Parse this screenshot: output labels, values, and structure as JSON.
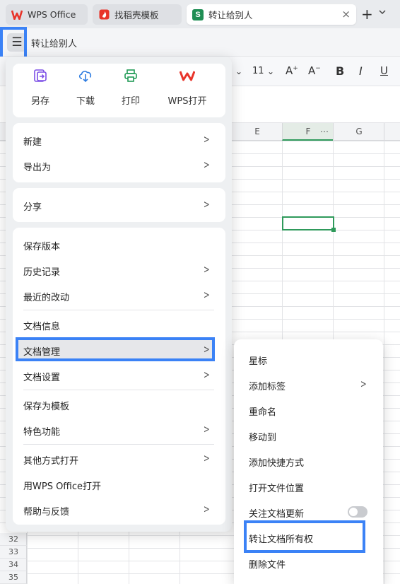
{
  "tabs": [
    {
      "label": "WPS Office",
      "icon": "wps-logo-icon",
      "active": false
    },
    {
      "label": "找稻壳模板",
      "icon": "docer-icon",
      "active": false
    },
    {
      "label": "转让给别人",
      "icon": "sheet-icon",
      "badge": "S",
      "active": true,
      "close": "×"
    }
  ],
  "tabbar": {
    "new_tab": "+",
    "more": "⌄"
  },
  "header": {
    "menu_icon": "☰",
    "doc_title": "转让给别人"
  },
  "toolbar": {
    "font_size": "11",
    "font_size_arrow": "⌄",
    "font_dropdown_arrow": "⌄",
    "grow": "A",
    "shrink": "A",
    "bold": "B",
    "italic": "I",
    "underline": "U"
  },
  "grid": {
    "columns": [
      {
        "label": "E"
      },
      {
        "label": "F",
        "extra": "⋯"
      },
      {
        "label": "G"
      }
    ],
    "rows": [
      "32",
      "33",
      "34",
      "35"
    ]
  },
  "menu": {
    "quick_actions": [
      {
        "label": "另存",
        "icon": "save-as-icon"
      },
      {
        "label": "下载",
        "icon": "download-icon"
      },
      {
        "label": "打印",
        "icon": "print-icon"
      },
      {
        "label": "WPS打开",
        "icon": "wps-open-icon"
      }
    ],
    "group1": [
      "新建",
      "导出为"
    ],
    "group2": [
      "分享"
    ],
    "group3": [
      "保存版本",
      "历史记录",
      "最近的改动",
      "文档信息",
      "文档管理",
      "文档设置",
      "保存为模板",
      "特色功能",
      "其他方式打开",
      "用WPS Office打开",
      "帮助与反馈"
    ]
  },
  "submenu": {
    "items": [
      "星标",
      "添加标签",
      "重命名",
      "移动到",
      "添加快捷方式",
      "打开文件位置",
      "关注文档更新",
      "转让文档所有权",
      "删除文件"
    ]
  },
  "colors": {
    "accent_blue": "#3b82f6",
    "sheet_green": "#1f8e54",
    "wps_red": "#e8342a",
    "purple": "#7b4ee6",
    "download_blue": "#2f7de1",
    "print_green": "#1f9a55"
  }
}
